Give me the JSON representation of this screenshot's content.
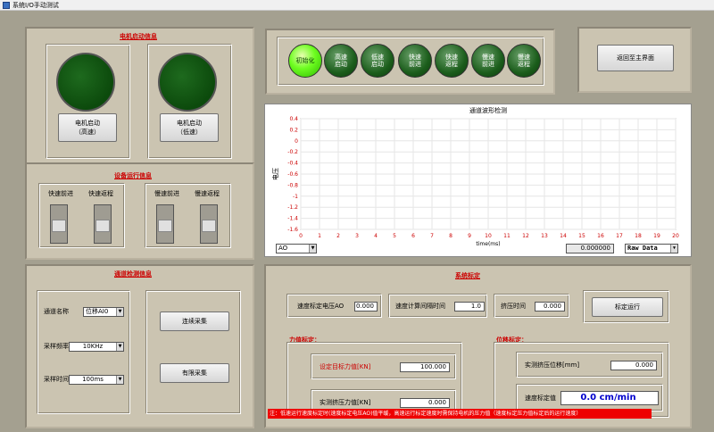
{
  "window": {
    "title": "系统I/O手动测试"
  },
  "motor": {
    "title": "电机启动信息",
    "buttons": [
      "电机启动\n（高速）",
      "电机启动\n（低速）"
    ]
  },
  "leds": [
    "初始化",
    "高速\n启动",
    "低速\n启动",
    "快速\n前进",
    "快速\n返程",
    "慢速\n前进",
    "慢速\n返程"
  ],
  "return_button": "返回至主界面",
  "equip": {
    "title": "设备运行信息",
    "switches": [
      "快速前进",
      "快速返程",
      "慢速前进",
      "慢速返程"
    ]
  },
  "chan": {
    "title": "通道检测信息",
    "name_label": "通道名称",
    "name_value": "位移AI0",
    "rate_label": "采样频率",
    "rate_value": "10KHz",
    "time_label": "采样时间",
    "time_value": "100ms",
    "cont_button": "连续采集",
    "finite_button": "有限采集"
  },
  "chart_data": {
    "type": "line",
    "title": "通道波形检测",
    "xlabel": "time(ms)",
    "ylabel": "电压",
    "xlim": [
      0,
      20
    ],
    "ylim": [
      -1.6,
      0.4
    ],
    "xticks": [
      "0",
      "1",
      "2",
      "3",
      "4",
      "5",
      "6",
      "7",
      "8",
      "9",
      "10",
      "11",
      "12",
      "13",
      "14",
      "15",
      "16",
      "17",
      "18",
      "19",
      "20"
    ],
    "yticks": [
      "0.4",
      "0.2",
      "0",
      "-0.2",
      "-0.4",
      "-0.6",
      "-0.8",
      "-1",
      "-1.2",
      "-1.4",
      "-1.6"
    ],
    "series": [],
    "grid": true
  },
  "graph_ctrl": {
    "channel": "AO",
    "value": "0.000000",
    "mode": "Raw Data"
  },
  "calib": {
    "title": "系统标定",
    "speed_v_label": "速度标定电压AO",
    "speed_v_value": "0.000",
    "interval_label": "速度计算间隔时间",
    "interval_value": "1.0",
    "squeeze_label": "挤压时间",
    "squeeze_value": "0.000",
    "run_button": "标定运行",
    "force_title": "力值标定：",
    "target_force_label": "设定目标力值[KN]",
    "target_force_value": "100.000",
    "actual_force_label": "实测挤压力值[KN]",
    "actual_force_value": "0.000",
    "disp_title": "位移标定：",
    "actual_disp_label": "实测挤压位移[mm]",
    "actual_disp_value": "0.000",
    "speed_label": "速度标定值",
    "speed_value": "0.0 cm/min",
    "note": "注：低速运行速度标定时(速度标定电压AO)值平缓，高速运行标定速度时需保持电机的压力值（速度标定压力值标定后的运行速度）"
  },
  "colors": {
    "panel": "#cbc4b1",
    "client": "#a4a090",
    "title_red": "#cc0000",
    "led_on": "#6dfd20",
    "led_off": "#1b5d1b",
    "note_bg": "#ee0000"
  }
}
